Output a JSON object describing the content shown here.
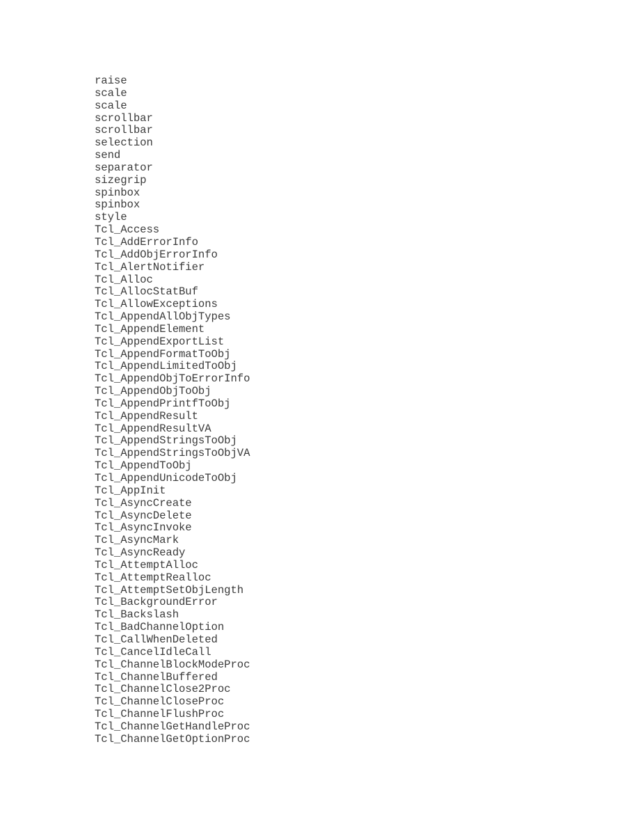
{
  "document": {
    "entries": [
      "raise",
      "scale",
      "scale",
      "scrollbar",
      "scrollbar",
      "selection",
      "send",
      "separator",
      "sizegrip",
      "spinbox",
      "spinbox",
      "style",
      "Tcl_Access",
      "Tcl_AddErrorInfo",
      "Tcl_AddObjErrorInfo",
      "Tcl_AlertNotifier",
      "Tcl_Alloc",
      "Tcl_AllocStatBuf",
      "Tcl_AllowExceptions",
      "Tcl_AppendAllObjTypes",
      "Tcl_AppendElement",
      "Tcl_AppendExportList",
      "Tcl_AppendFormatToObj",
      "Tcl_AppendLimitedToObj",
      "Tcl_AppendObjToErrorInfo",
      "Tcl_AppendObjToObj",
      "Tcl_AppendPrintfToObj",
      "Tcl_AppendResult",
      "Tcl_AppendResultVA",
      "Tcl_AppendStringsToObj",
      "Tcl_AppendStringsToObjVA",
      "Tcl_AppendToObj",
      "Tcl_AppendUnicodeToObj",
      "Tcl_AppInit",
      "Tcl_AsyncCreate",
      "Tcl_AsyncDelete",
      "Tcl_AsyncInvoke",
      "Tcl_AsyncMark",
      "Tcl_AsyncReady",
      "Tcl_AttemptAlloc",
      "Tcl_AttemptRealloc",
      "Tcl_AttemptSetObjLength",
      "Tcl_BackgroundError",
      "Tcl_Backslash",
      "Tcl_BadChannelOption",
      "Tcl_CallWhenDeleted",
      "Tcl_CancelIdleCall",
      "Tcl_ChannelBlockModeProc",
      "Tcl_ChannelBuffered",
      "Tcl_ChannelClose2Proc",
      "Tcl_ChannelCloseProc",
      "Tcl_ChannelFlushProc",
      "Tcl_ChannelGetHandleProc",
      "Tcl_ChannelGetOptionProc"
    ]
  }
}
